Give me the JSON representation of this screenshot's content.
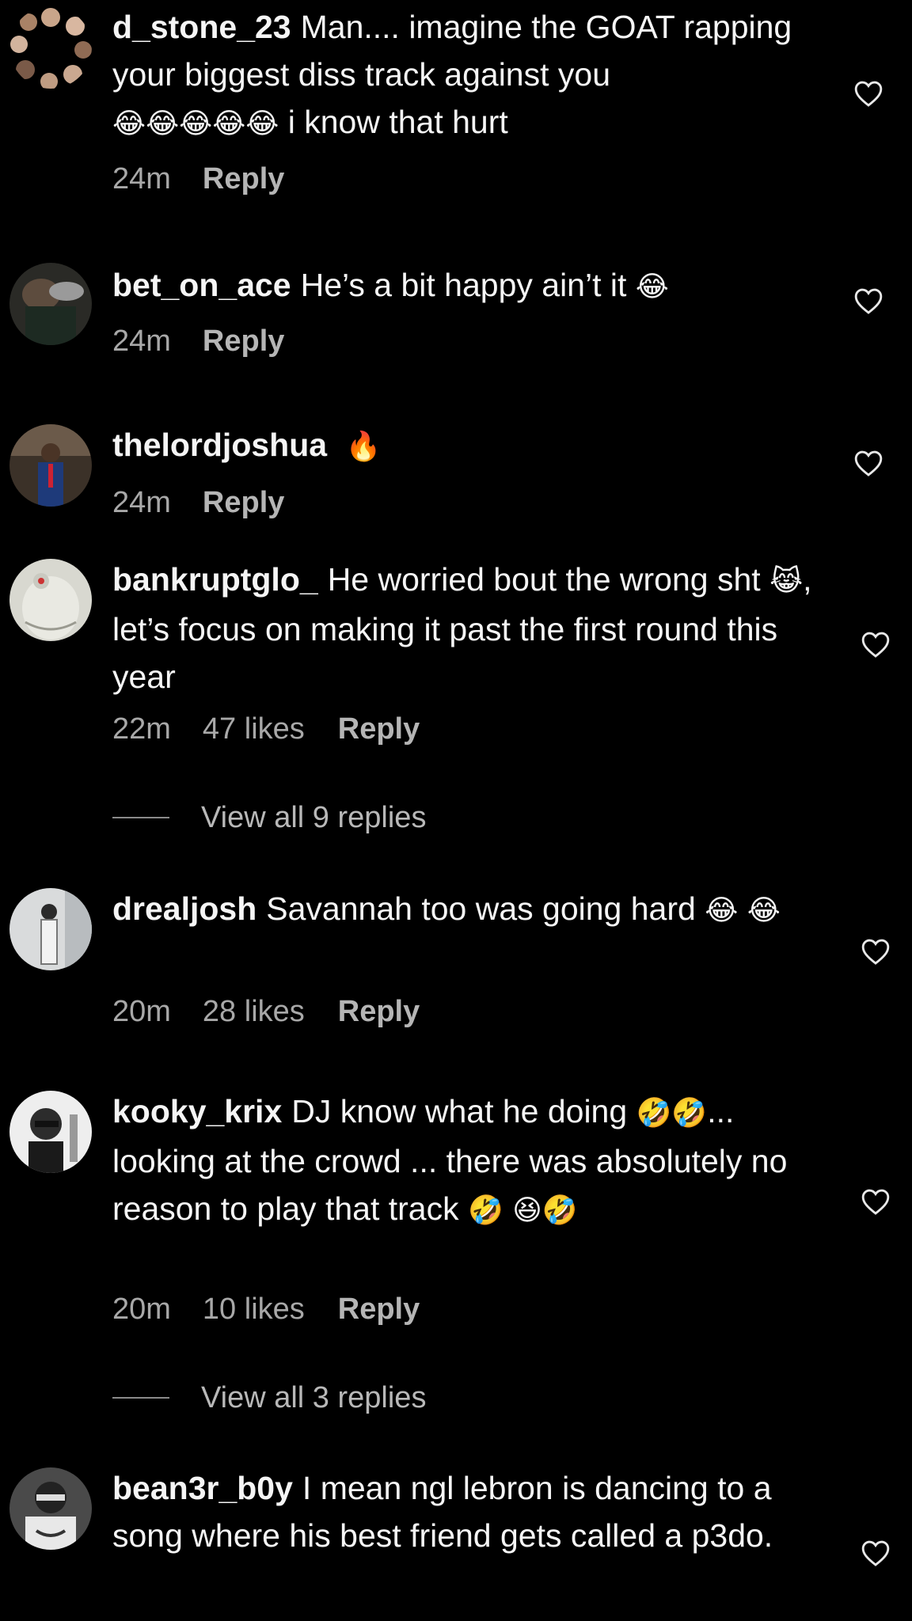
{
  "comments": [
    {
      "username": "d_stone_23",
      "text": "Man.... imagine the GOAT rapping your biggest diss track against you",
      "emoji": "😂😂😂😂😂",
      "text_after": " i know that hurt",
      "time": "24m",
      "likes": "",
      "reply": "Reply"
    },
    {
      "username": "bet_on_ace",
      "text": "He’s a bit happy ain’t it",
      "emoji": "😂",
      "time": "24m",
      "likes": "",
      "reply": "Reply"
    },
    {
      "username": "thelordjoshua",
      "text": "",
      "emoji": "🔥",
      "time": "24m",
      "likes": "",
      "reply": "Reply"
    },
    {
      "username": "bankruptglo_",
      "text": "He worried bout the wrong sht",
      "emoji": "😹",
      "text_after": ", let’s focus on making it past the first round this year",
      "time": "22m",
      "likes": "47 likes",
      "reply": "Reply",
      "view_replies": "View all 9 replies"
    },
    {
      "username": "drealjosh",
      "text": "Savannah too was going hard",
      "emoji": "😂 😂",
      "time": "20m",
      "likes": "28 likes",
      "reply": "Reply"
    },
    {
      "username": "kooky_krix",
      "text": "DJ know what he doing",
      "emoji": "🤣🤣",
      "text_after": "... looking at the crowd ... there was absolutely no reason to play that track",
      "emoji_after": "🤣 😆🤣",
      "time": "20m",
      "likes": "10 likes",
      "reply": "Reply",
      "view_replies": "View all 3 replies"
    },
    {
      "username": "bean3r_b0y",
      "text": "I mean ngl lebron is dancing to a song where his best friend gets called a p3do.",
      "time": "",
      "likes": "",
      "reply": ""
    }
  ],
  "icons": {
    "like": "heart-outline-icon"
  },
  "colors": {
    "background": "#000000",
    "text": "#f5f5f5",
    "meta": "#a8a8a8"
  }
}
